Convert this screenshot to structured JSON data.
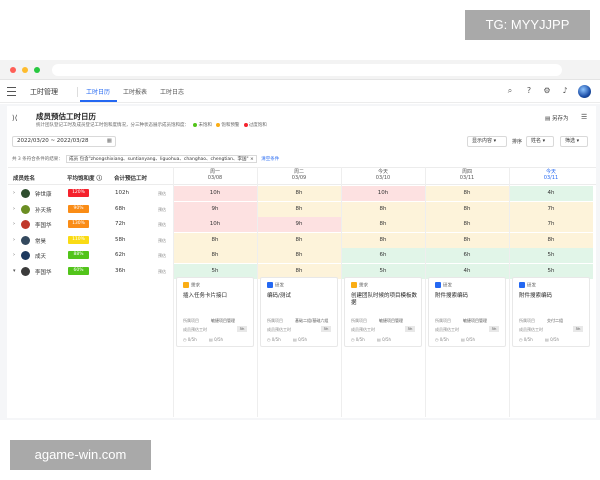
{
  "watermarks": {
    "top": "TG: MYYJJPP",
    "bottom": "agame-win.com"
  },
  "header": {
    "app_title": "工时管理",
    "tabs": [
      {
        "label": "工时日历",
        "active": true
      },
      {
        "label": "工时报表"
      },
      {
        "label": "工时日志"
      }
    ]
  },
  "panel": {
    "title": "成员预估工时日历",
    "subtitle": "统计团队登记工时及成员登记工时饱和度情况，分三种状态展示成员饱和度：",
    "legend": [
      {
        "label": "未饱和",
        "color": "#52c41a"
      },
      {
        "label": "饱和预警",
        "color": "#faad14"
      },
      {
        "label": "过度饱和",
        "color": "#f5222d"
      }
    ],
    "save_as": "另存为"
  },
  "controls": {
    "date_range": "2022/03/20  ~  2022/03/28",
    "display": "显示内容",
    "sort_label": "排序",
    "sort_value": "姓名",
    "filter": "筛选"
  },
  "filter_bar": {
    "text": "共 3 条符合条件的结果：",
    "tag": "成员 包含\"zhongshixiang、suntianyang、liguohua、changhao、chengtian、李国\"",
    "clear": "清空条件"
  },
  "columns": {
    "name": "成员姓名",
    "saturation": "平均饱和度",
    "total": "合计预估工时"
  },
  "days": [
    {
      "weekday": "周一",
      "date": "03/08"
    },
    {
      "weekday": "周二",
      "date": "03/09"
    },
    {
      "weekday": "今天",
      "date": "03/10"
    },
    {
      "weekday": "周四",
      "date": "03/11"
    },
    {
      "weekday": "今天",
      "date": "03/11",
      "today": true
    }
  ],
  "forecast_label": "预估",
  "members": [
    {
      "name": "钟世康",
      "saturation": "120%",
      "badge_color": "#f5222d",
      "total": "102h",
      "hours": [
        "10h",
        "8h",
        "10h",
        "8h",
        "4h"
      ],
      "avatar": "#2f4f2f"
    },
    {
      "name": "孙天扬",
      "saturation": "90%",
      "badge_color": "#fa8c16",
      "total": "68h",
      "hours": [
        "9h",
        "8h",
        "8h",
        "8h",
        "7h"
      ],
      "avatar": "#6b8e23"
    },
    {
      "name": "李国华",
      "saturation": "130%",
      "badge_color": "#fa8c16",
      "total": "72h",
      "hours": [
        "10h",
        "9h",
        "8h",
        "8h",
        "7h"
      ],
      "avatar": "#c0392b"
    },
    {
      "name": "常昊",
      "saturation": "110%",
      "badge_color": "#fadb14",
      "total": "58h",
      "hours": [
        "8h",
        "8h",
        "8h",
        "8h",
        "8h"
      ],
      "avatar": "#34495e"
    },
    {
      "name": "成天",
      "saturation": "88%",
      "badge_color": "#52c41a",
      "total": "62h",
      "hours": [
        "8h",
        "8h",
        "6h",
        "6h",
        "5h"
      ],
      "avatar": "#1e3a5f"
    },
    {
      "name": "李国华",
      "saturation": "60%",
      "badge_color": "#52c41a",
      "total": "36h",
      "hours": [
        "5h",
        "8h",
        "5h",
        "4h",
        "5h"
      ],
      "avatar": "#3b3b3b",
      "expanded": true
    }
  ],
  "tasks": [
    {
      "type": "需求",
      "type_color": "#faad14",
      "title": "插入任务卡片接口",
      "project_label": "所属项目",
      "project": "敏捷项目管理",
      "owner": "成员预估工时",
      "owner_chip": "5h",
      "progress": "0/5h",
      "estimate": "0/5h"
    },
    {
      "type": "研发",
      "type_color": "#2468f2",
      "title": "编码/测试",
      "project_label": "所属项目",
      "project": "基础二组/基础六组",
      "owner": "成员预估工时",
      "owner_chip": "5h",
      "progress": "0/5h",
      "estimate": "0/5h"
    },
    {
      "type": "需求",
      "type_color": "#faad14",
      "title": "创建团队时候的项目模板数据",
      "project_label": "所属项目",
      "project": "敏捷项目管理",
      "owner": "成员预估工时",
      "owner_chip": "5h",
      "progress": "0/5h",
      "estimate": "0/5h"
    },
    {
      "type": "研发",
      "type_color": "#2468f2",
      "title": "附件搜索编码",
      "project_label": "所属项目",
      "project": "敏捷项目管理",
      "owner": "成员预估工时",
      "owner_chip": "5h",
      "progress": "0/5h",
      "estimate": "0/5h"
    },
    {
      "type": "研发",
      "type_color": "#2468f2",
      "title": "附件搜索编码",
      "project_label": "所属项目",
      "project": "交付二组",
      "owner": "成员预估工时",
      "owner_chip": "5h",
      "progress": "0/5h",
      "estimate": "0/5h"
    }
  ]
}
